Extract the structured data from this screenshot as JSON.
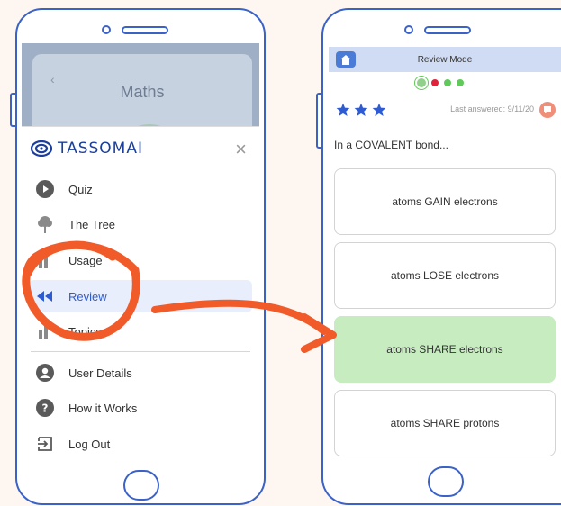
{
  "left_phone": {
    "background_title": "Maths",
    "background_back": "‹",
    "drawer": {
      "logo_text": "TASSOMAI",
      "close_label": "×",
      "items": [
        {
          "label": "Quiz",
          "icon": "play-icon"
        },
        {
          "label": "The Tree",
          "icon": "tree-icon"
        },
        {
          "label": "Usage",
          "icon": "chart-icon"
        },
        {
          "label": "Review",
          "icon": "rewind-icon",
          "active": true
        },
        {
          "label": "Topics",
          "icon": "bar-icon"
        },
        {
          "label": "User Details",
          "icon": "user-icon"
        },
        {
          "label": "How it Works",
          "icon": "help-icon"
        },
        {
          "label": "Log Out",
          "icon": "logout-icon"
        }
      ]
    }
  },
  "right_phone": {
    "mode_title": "Review Mode",
    "progress_dots": [
      "#8fd18a",
      "#e0233a",
      "#5fc95a",
      "#5fc95a"
    ],
    "stars": 3,
    "last_answered": "Last answered: 9/11/20",
    "question": "In a COVALENT bond...",
    "answers": [
      {
        "label": "atoms GAIN electrons",
        "correct": false
      },
      {
        "label": "atoms LOSE electrons",
        "correct": false
      },
      {
        "label": "atoms SHARE electrons",
        "correct": true
      },
      {
        "label": "atoms SHARE protons",
        "correct": false
      }
    ]
  },
  "colors": {
    "phone_outline": "#3b62c7",
    "annotation": "#f15a29",
    "correct_answer": "#c6ecc0",
    "active_menu": "#e8eefb"
  }
}
